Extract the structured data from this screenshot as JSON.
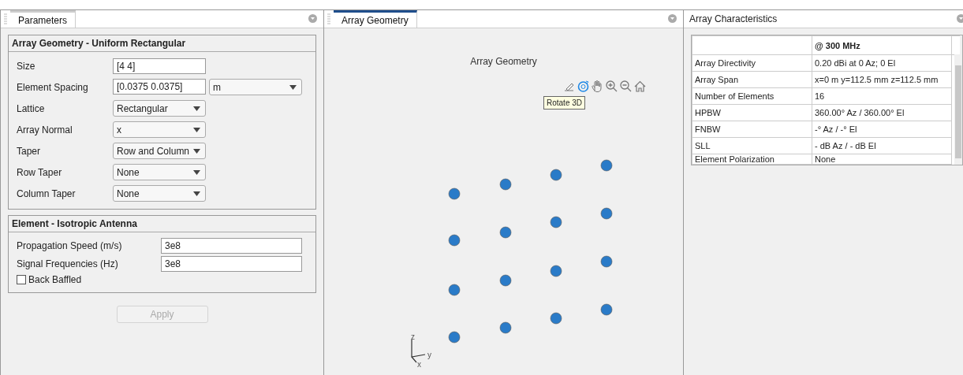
{
  "parameters_panel": {
    "tab": {
      "label": "Parameters",
      "selected": true
    },
    "groups": [
      {
        "title": "Array Geometry - Uniform Rectangular",
        "fields": [
          {
            "label": "Size",
            "kind": "text",
            "value": "[4 4]"
          },
          {
            "label": "Element Spacing",
            "kind": "text",
            "value": "[0.0375 0.0375]",
            "unit": "m"
          },
          {
            "label": "Lattice",
            "kind": "dropdown",
            "value": "Rectangular"
          },
          {
            "label": "Array Normal",
            "kind": "dropdown",
            "value": "x"
          },
          {
            "label": "Taper",
            "kind": "dropdown",
            "value": "Row and Column"
          },
          {
            "label": "Row Taper",
            "kind": "dropdown",
            "value": "None"
          },
          {
            "label": "Column Taper",
            "kind": "dropdown",
            "value": "None"
          }
        ]
      },
      {
        "title": "Element - Isotropic Antenna",
        "fields": [
          {
            "label": "Propagation Speed (m/s)",
            "kind": "text",
            "value": "3e8"
          },
          {
            "label": "Signal Frequencies (Hz)",
            "kind": "text",
            "value": "3e8"
          },
          {
            "label": "Back Baffled",
            "kind": "checkbox",
            "checked": false
          }
        ]
      }
    ],
    "apply_button": {
      "label": "Apply",
      "disabled": true
    }
  },
  "geometry_panel": {
    "tab": {
      "label": "Array Geometry",
      "selected": true
    },
    "plot_title": "Array Geometry",
    "toolbar": [
      {
        "kind": "brush",
        "selected": false
      },
      {
        "kind": "rotate",
        "selected": true
      },
      {
        "kind": "pan",
        "selected": false
      },
      {
        "kind": "zoom-in",
        "selected": false
      },
      {
        "kind": "zoom-out",
        "selected": false
      },
      {
        "kind": "home",
        "selected": false
      }
    ],
    "tooltip": "Rotate 3D",
    "axes": {
      "z": "z",
      "y": "y",
      "x": "x"
    }
  },
  "characteristics_panel": {
    "title": "Array Characteristics",
    "table": {
      "columns": [
        "@ 300 MHz"
      ],
      "rows": [
        {
          "name": "Array Directivity",
          "value": "0.20 dBi at 0 Az; 0 El"
        },
        {
          "name": "Array Span",
          "value": "x=0 m y=112.5 mm z=112.5 mm"
        },
        {
          "name": "Number of Elements",
          "value": "16"
        },
        {
          "name": "HPBW",
          "value": "360.00° Az / 360.00° El"
        },
        {
          "name": "FNBW",
          "value": "-° Az / -° El"
        },
        {
          "name": "SLL",
          "value": "- dB Az / - dB El"
        },
        {
          "name": "Element Polarization",
          "value": "None"
        }
      ]
    }
  }
}
